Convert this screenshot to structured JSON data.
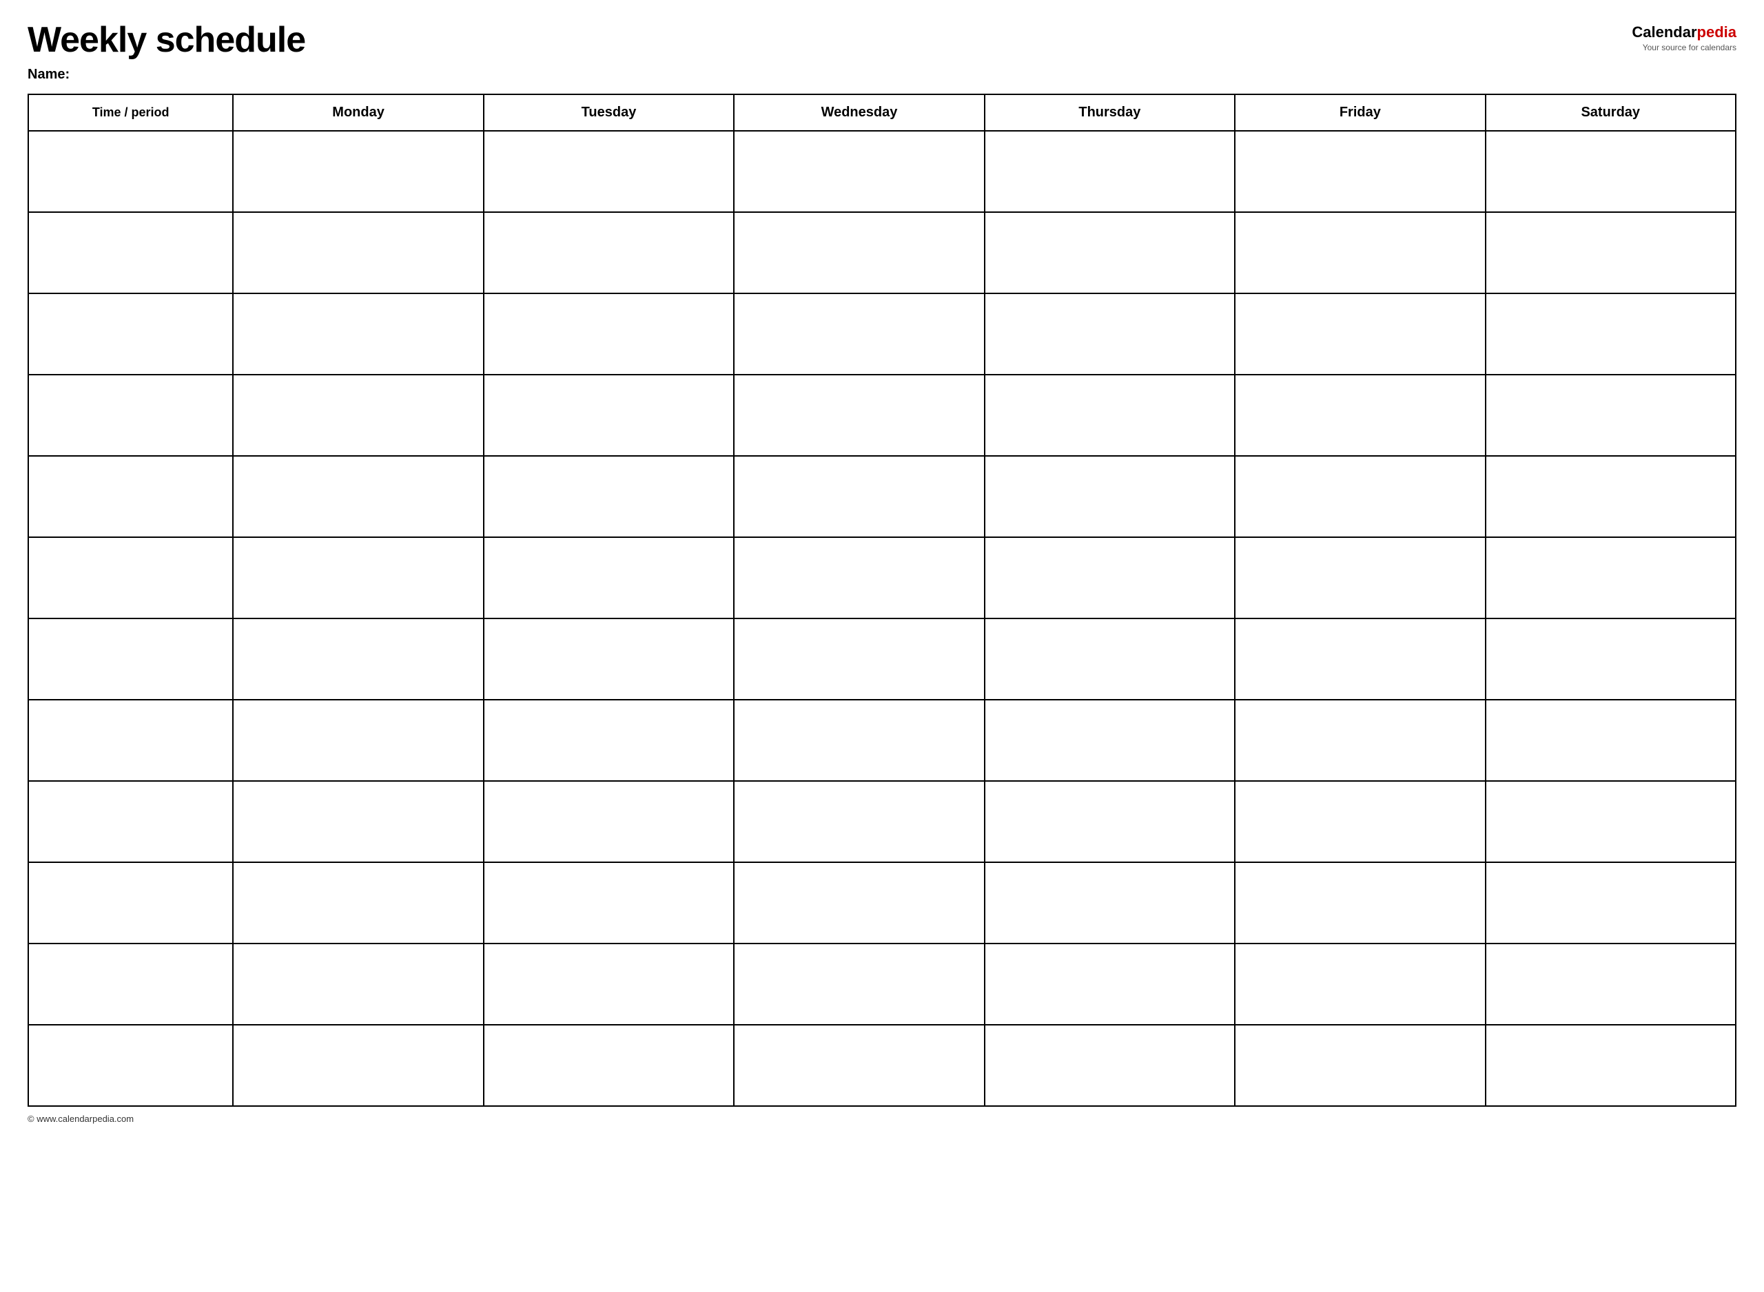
{
  "header": {
    "title": "Weekly schedule",
    "name_label": "Name:",
    "logo_calendar": "Calendar",
    "logo_pedia": "pedia",
    "logo_subtitle": "Your source for calendars"
  },
  "table": {
    "columns": [
      {
        "id": "time",
        "label": "Time / period"
      },
      {
        "id": "monday",
        "label": "Monday"
      },
      {
        "id": "tuesday",
        "label": "Tuesday"
      },
      {
        "id": "wednesday",
        "label": "Wednesday"
      },
      {
        "id": "thursday",
        "label": "Thursday"
      },
      {
        "id": "friday",
        "label": "Friday"
      },
      {
        "id": "saturday",
        "label": "Saturday"
      }
    ],
    "row_count": 12
  },
  "footer": {
    "url": "© www.calendarpedia.com"
  }
}
